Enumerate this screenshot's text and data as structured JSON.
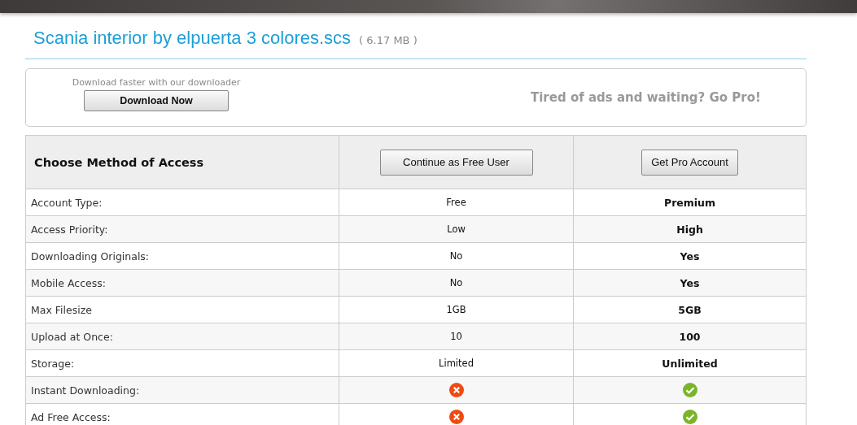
{
  "file": {
    "name": "Scania interior by elpuerta 3 colores.scs",
    "size": "( 6.17 MB )"
  },
  "promo": {
    "downloader_text": "Download faster with our downloader",
    "download_button": "Download Now",
    "pro_text": "Tired of ads and waiting? Go Pro!"
  },
  "table": {
    "heading": "Choose Method of Access",
    "free_button": "Continue as Free User",
    "pro_button": "Get Pro Account",
    "rows": [
      {
        "kind": "text",
        "label": "Account Type:",
        "free": "Free",
        "pro": "Premium"
      },
      {
        "kind": "text",
        "label": "Access Priority:",
        "free": "Low",
        "pro": "High"
      },
      {
        "kind": "text",
        "label": "Downloading Originals:",
        "free": "No",
        "pro": "Yes"
      },
      {
        "kind": "text",
        "label": "Mobile Access:",
        "free": "No",
        "pro": "Yes"
      },
      {
        "kind": "text",
        "label": "Max Filesize",
        "free": "1GB",
        "pro": "5GB"
      },
      {
        "kind": "text",
        "label": "Upload at Once:",
        "free": "10",
        "pro": "100"
      },
      {
        "kind": "text",
        "label": "Storage:",
        "free": "Limited",
        "pro": "Unlimited"
      },
      {
        "kind": "icon",
        "label": "Instant Downloading:",
        "free_available": false,
        "pro_available": true
      },
      {
        "kind": "icon",
        "label": "Ad Free Access:",
        "free_available": false,
        "pro_available": true
      }
    ]
  }
}
